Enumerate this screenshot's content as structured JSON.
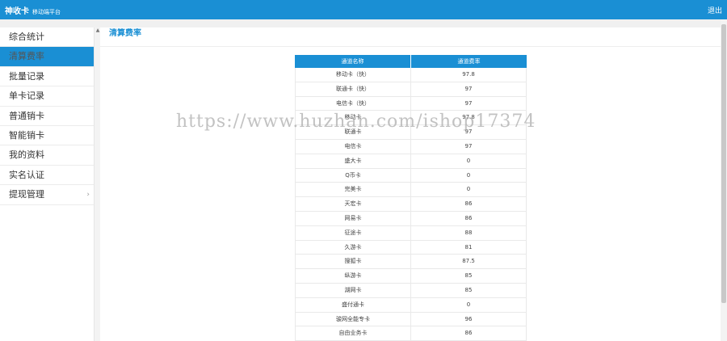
{
  "header": {
    "brand": "神收卡",
    "subtitle": "移动端平台",
    "logout": "退出"
  },
  "sidebar": {
    "items": [
      {
        "label": "综合统计",
        "active": false,
        "chevron": ""
      },
      {
        "label": "清算费率",
        "active": true,
        "chevron": ""
      },
      {
        "label": "批量记录",
        "active": false,
        "chevron": ""
      },
      {
        "label": "单卡记录",
        "active": false,
        "chevron": ""
      },
      {
        "label": "普通销卡",
        "active": false,
        "chevron": ""
      },
      {
        "label": "智能销卡",
        "active": false,
        "chevron": ""
      },
      {
        "label": "我的资料",
        "active": false,
        "chevron": ""
      },
      {
        "label": "实名认证",
        "active": false,
        "chevron": ""
      },
      {
        "label": "提现管理",
        "active": false,
        "chevron": "›"
      }
    ],
    "scroll_arrow": "▲"
  },
  "main": {
    "title": "清算费率",
    "table": {
      "headers": [
        "通道名称",
        "通道费率"
      ],
      "rows": [
        [
          "移动卡（快）",
          "97.8"
        ],
        [
          "联通卡（快）",
          "97"
        ],
        [
          "电信卡（快）",
          "97"
        ],
        [
          "移动卡",
          "97.8"
        ],
        [
          "联通卡",
          "97"
        ],
        [
          "电信卡",
          "97"
        ],
        [
          "盛大卡",
          "0"
        ],
        [
          "Q币卡",
          "0"
        ],
        [
          "完美卡",
          "0"
        ],
        [
          "天宏卡",
          "86"
        ],
        [
          "网易卡",
          "86"
        ],
        [
          "征途卡",
          "88"
        ],
        [
          "久游卡",
          "81"
        ],
        [
          "搜狐卡",
          "87.5"
        ],
        [
          "纵游卡",
          "85"
        ],
        [
          "湖网卡",
          "85"
        ],
        [
          "盛付通卡",
          "0"
        ],
        [
          "骏网全能专卡",
          "96"
        ],
        [
          "自由业务卡",
          "86"
        ]
      ]
    }
  },
  "watermark": "https://www.huzhan.com/ishop17374",
  "colors": {
    "accent": "#1a8fd4"
  }
}
